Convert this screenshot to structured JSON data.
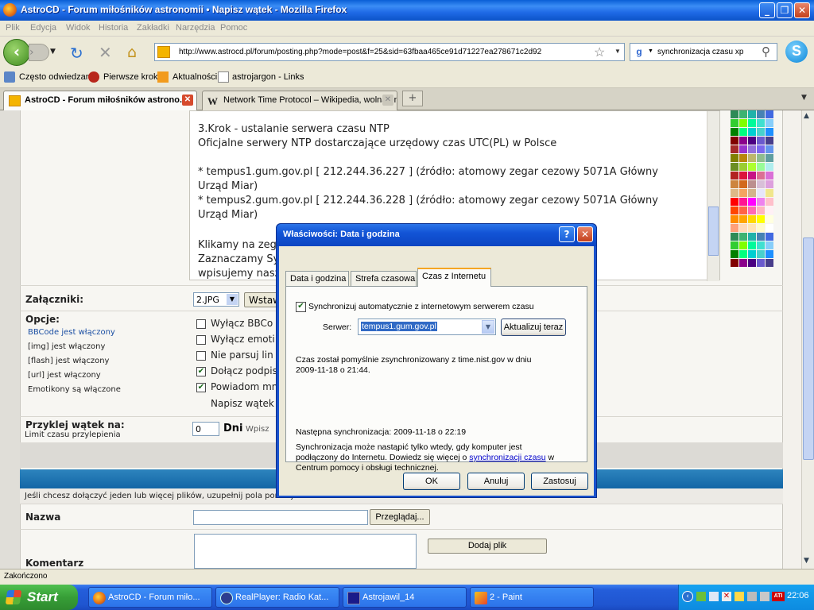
{
  "window": {
    "title": "AstroCD - Forum miłośników astronomii • Napisz wątek - Mozilla Firefox",
    "min_icon": "minimize-icon",
    "max_icon": "restore-icon",
    "close_icon": "close-icon"
  },
  "menu": [
    "Plik",
    "Edycja",
    "Widok",
    "Historia",
    "Zakładki",
    "Narzędzia",
    "Pomoc"
  ],
  "nav": {
    "url": "http://www.astrocd.pl/forum/posting.php?mode=post&f=25&sid=63fbaa465ce91d71227ea278671c2d92",
    "search": "synchronizacja czasu xp"
  },
  "bookmarks": [
    "Często odwiedzane",
    "Pierwsze kroki",
    "Aktualności",
    "astrojargon - Links"
  ],
  "tabs": [
    {
      "label": "AstroCD - Forum miłośników astrono..."
    },
    {
      "label": "Network Time Protocol – Wikipedia, wolna en..."
    }
  ],
  "editor": {
    "lines": [
      "3.Krok - ustalanie serwera czasu NTP",
      "Oficjalne serwery NTP dostarczające urzędowy czas UTC(PL) w Polsce",
      "",
      "    * tempus1.gum.gov.pl [ 212.244.36.227 ] (źródło: atomowy zegar cezowy 5071A Główny",
      "Urząd Miar)",
      "    * tempus2.gum.gov.pl [ 212.244.36.228 ] (źródło: atomowy zegar cezowy 5071A Główny",
      "Urząd Miar)",
      "",
      "Klikamy na zega",
      "Zaznaczamy Sy",
      "wpisujemy nasz"
    ]
  },
  "form": {
    "attachments_label": "Załączniki:",
    "attach_select": "2.JPG",
    "insert_button": "Wstaw",
    "options_label": "Opcje:",
    "opt_lines": [
      "BBCode jest włączony",
      "[img] jest włączony",
      "[flash] jest włączony",
      "[url] jest włączony",
      "Emotikony są włączone"
    ],
    "checkboxes": [
      {
        "label": "Wyłącz BBCo",
        "checked": false
      },
      {
        "label": "Wyłącz emoti",
        "checked": false
      },
      {
        "label": "Nie parsuj lin",
        "checked": false
      },
      {
        "label": "Dołącz podpis",
        "checked": true
      },
      {
        "label": "Powiadom mn",
        "checked": true
      }
    ],
    "write_thread": "Napisz wątek",
    "sticky_label": "Przyklej wątek na:",
    "sticky_sub": "Limit czasu przylepienia",
    "sticky_value": "0",
    "days": "Dni",
    "wpisz": "Wpisz",
    "attach_info": "Jeśli chcesz dołączyć jeden lub więcej plików, uzupełnij pola poniżej.",
    "name_label": "Nazwa",
    "browse_button": "Przeglądaj...",
    "comment_label": "Komentarz",
    "add_file_button": "Dodaj plik"
  },
  "dialog": {
    "title": "Właściwości: Data i godzina",
    "help": "?",
    "tabs": [
      "Data i godzina",
      "Strefa czasowa",
      "Czas z Internetu"
    ],
    "active_tab": 2,
    "sync_checkbox": "Synchronizuj automatycznie z internetowym serwerem czasu",
    "sync_checked": true,
    "server_label": "Serwer:",
    "server_value": "tempus1.gum.gov.pl",
    "update_button": "Aktualizuj teraz",
    "status_line1": "Czas został pomyślnie zsynchronizowany z time.nist.gov w dniu",
    "status_line2": "2009-11-18 o 21:44.",
    "next_sync": "Następna synchronizacja: 2009-11-18 o 22:19",
    "info_line1": "Synchronizacja może nastąpić tylko wtedy, gdy komputer jest",
    "info_line2a": "podłączony do Internetu. Dowiedz się więcej o ",
    "info_link": "synchronizacji czasu",
    "info_line2b": " w",
    "info_line3": "Centrum pomocy i obsługi technicznej.",
    "ok": "OK",
    "cancel": "Anuluj",
    "apply": "Zastosuj"
  },
  "status": "Zakończono",
  "taskbar": {
    "start": "Start",
    "items": [
      "AstroCD - Forum miło...",
      "RealPlayer: Radio Kat...",
      "Astrojawil_14",
      "2 - Paint"
    ],
    "clock": "22:06"
  }
}
